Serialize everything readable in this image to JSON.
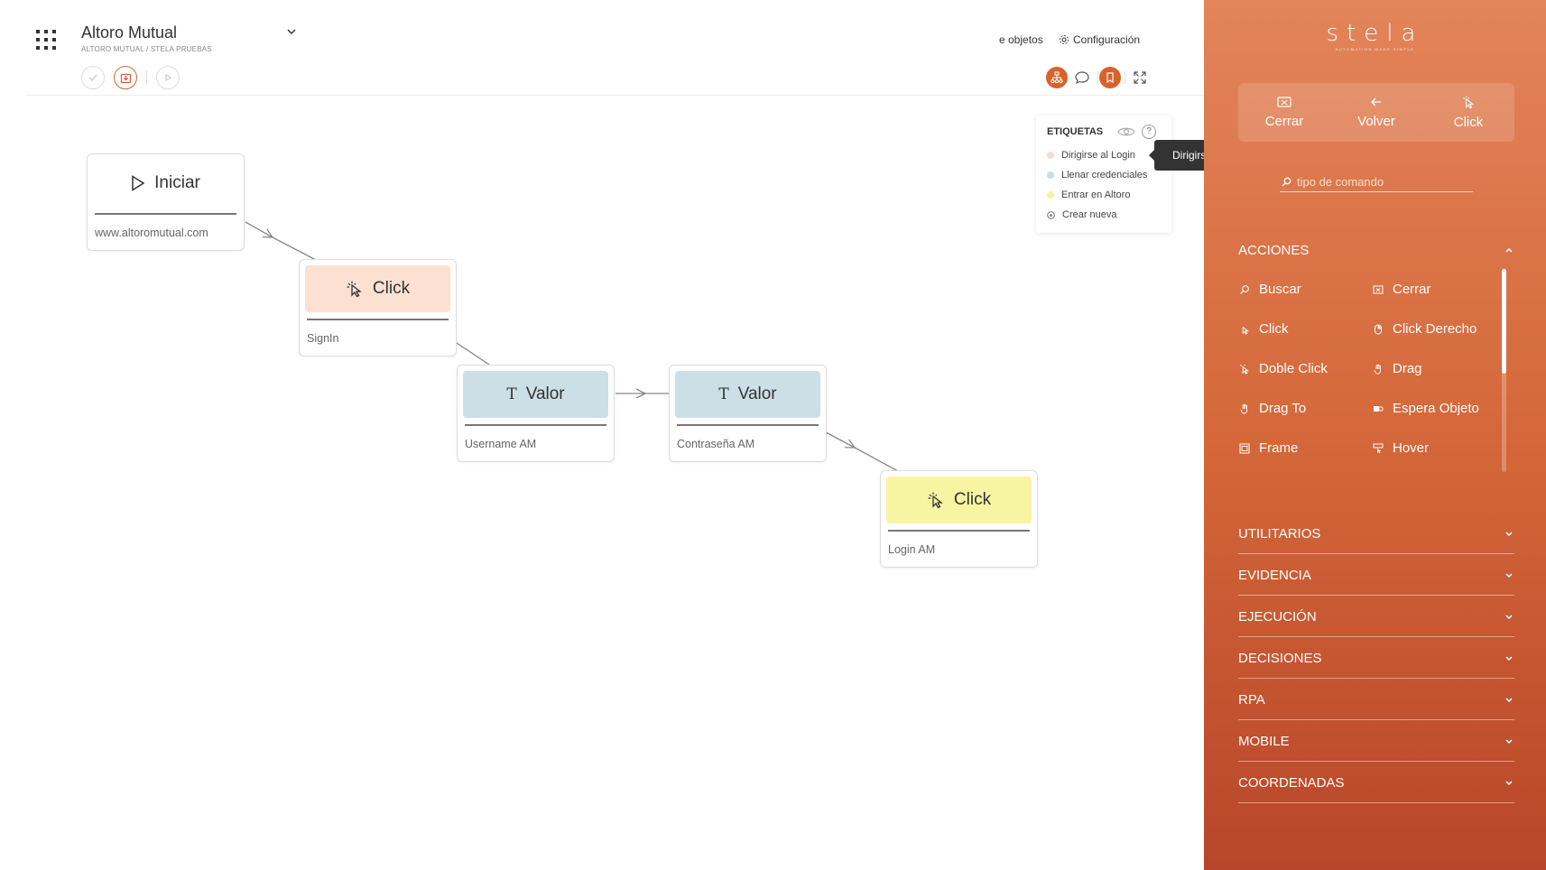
{
  "project": {
    "title": "Altoro Mutual",
    "subtitle": "ALTORO MUTUAL / STELA PRUEBAS"
  },
  "header": {
    "objects_link": "e objetos",
    "config_link": "Configuración"
  },
  "labels_panel": {
    "title": "ETIQUETAS",
    "help": "?",
    "items": [
      {
        "label": "Dirigirse al Login",
        "color": "#f9dccb"
      },
      {
        "label": "Llenar credenciales",
        "color": "#c9dde5"
      },
      {
        "label": "Entrar en Altoro",
        "color": "#f6f3a0"
      }
    ],
    "create_label": "Crear nueva"
  },
  "tooltip": "Dirigirse al Login",
  "nodes": [
    {
      "title": "Iniciar",
      "caption": "www.altoromutual.com",
      "icon": "play-icon",
      "color": "#ffffff"
    },
    {
      "title": "Click",
      "caption": "SignIn",
      "icon": "pointer-click-icon",
      "color": "#fce1d2"
    },
    {
      "title": "Valor",
      "caption": "Username AM",
      "icon": "text-t-icon",
      "color": "#cddfe6"
    },
    {
      "title": "Valor",
      "caption": "Contraseña AM",
      "icon": "text-t-icon",
      "color": "#cddfe6"
    },
    {
      "title": "Click",
      "caption": "Login AM",
      "icon": "pointer-click-icon",
      "color": "#f8f5a2"
    }
  ],
  "panel": {
    "brand": "stela",
    "brand_sub": "AUTOMATION MADE SIMPLE",
    "quick": [
      {
        "label": "Cerrar",
        "icon": "close-window-icon"
      },
      {
        "label": "Volver",
        "icon": "arrow-left-icon"
      },
      {
        "label": "Click",
        "icon": "pointer-click-icon"
      }
    ],
    "search_placeholder": "tipo de comando",
    "acciones_title": "ACCIONES",
    "actions": [
      {
        "label": "Buscar",
        "icon": "search-icon"
      },
      {
        "label": "Cerrar",
        "icon": "close-window-icon"
      },
      {
        "label": "Click",
        "icon": "pointer-click-icon"
      },
      {
        "label": "Click Derecho",
        "icon": "mouse-right-icon"
      },
      {
        "label": "Doble Click",
        "icon": "double-click-icon"
      },
      {
        "label": "Drag",
        "icon": "drag-icon"
      },
      {
        "label": "Drag To",
        "icon": "drag-to-icon"
      },
      {
        "label": "Espera Objeto",
        "icon": "wait-object-icon"
      },
      {
        "label": "Frame",
        "icon": "frame-icon"
      },
      {
        "label": "Hover",
        "icon": "hover-icon"
      }
    ],
    "sections": [
      "UTILITARIOS",
      "EVIDENCIA",
      "EJECUCIÓN",
      "DECISIONES",
      "RPA",
      "MOBILE",
      "COORDENADAS"
    ]
  },
  "colors": {
    "accent": "#d9622b",
    "panel_top": "#e3845a",
    "panel_bottom": "#b8462a"
  }
}
